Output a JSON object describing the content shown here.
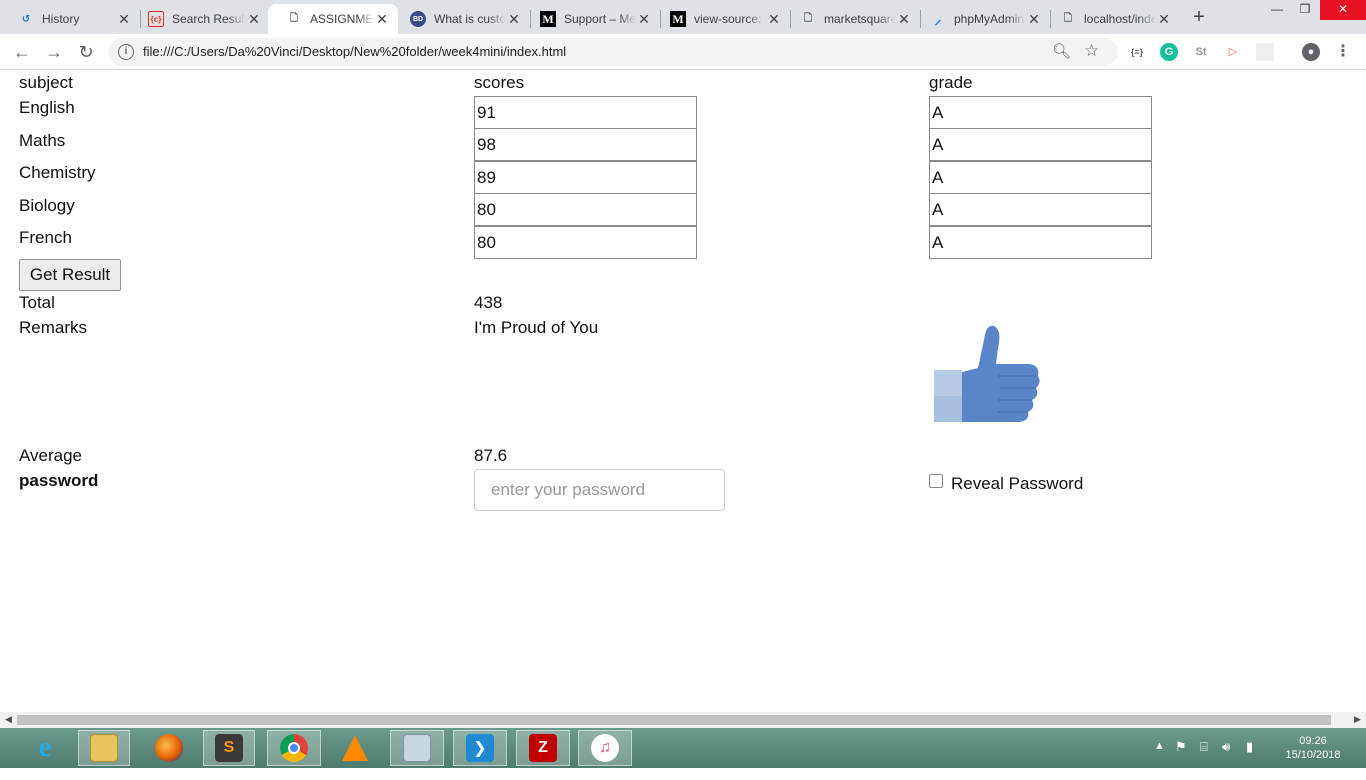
{
  "browser": {
    "tabs": [
      {
        "label": "History",
        "icon": "history-icon"
      },
      {
        "label": "Search Results",
        "icon": "code-icon"
      },
      {
        "label": "ASSIGNMENT",
        "icon": "document-icon"
      },
      {
        "label": "What is customer",
        "icon": "site-icon"
      },
      {
        "label": "Support – Medium",
        "icon": "medium-icon"
      },
      {
        "label": "view-source:",
        "icon": "medium-icon"
      },
      {
        "label": "marketsquare",
        "icon": "document-icon"
      },
      {
        "label": "phpMyAdmin",
        "icon": "phpmyadmin-icon"
      },
      {
        "label": "localhost/index",
        "icon": "document-icon"
      }
    ],
    "url": "file:///C:/Users/Da%20Vinci/Desktop/New%20folder/week4mini/index.html"
  },
  "form": {
    "headers": {
      "subject": "subject",
      "scores": "scores",
      "grade": "grade"
    },
    "rows": [
      {
        "subject": "English",
        "score": "91",
        "grade": "A"
      },
      {
        "subject": "Maths",
        "score": "98",
        "grade": "A"
      },
      {
        "subject": "Chemistry",
        "score": "89",
        "grade": "A"
      },
      {
        "subject": "Biology",
        "score": "80",
        "grade": "A"
      },
      {
        "subject": "French",
        "score": "80",
        "grade": "A"
      }
    ],
    "button_label": "Get Result",
    "total_label": "Total",
    "total_value": "438",
    "remarks_label": "Remarks",
    "remarks_value": "I'm Proud of You",
    "remarks_image": "thumbs-up-icon",
    "average_label": "Average",
    "average_value": "87.6",
    "password_label": "password",
    "password_placeholder": "enter your password",
    "reveal_label": "Reveal Password",
    "reveal_checked": false
  },
  "taskbar": {
    "apps": [
      "internet-explorer-icon",
      "file-explorer-icon",
      "firefox-icon",
      "sublime-text-icon",
      "chrome-icon",
      "vlc-icon",
      "system-icon",
      "vscode-icon",
      "filezilla-icon",
      "itunes-icon"
    ],
    "time": "09:26",
    "date": "15/10/2018"
  },
  "colors": {
    "thumb": "#5b85c9",
    "thumb_light": "#b8cbe6",
    "taskbar": "#5a8a7d"
  }
}
